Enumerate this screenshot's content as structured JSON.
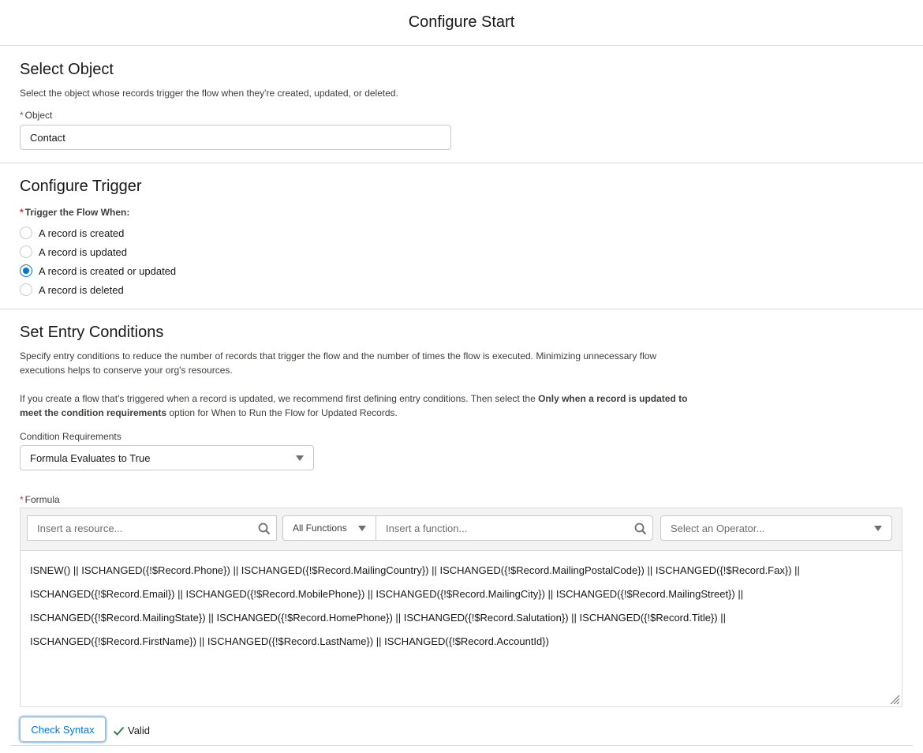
{
  "header": {
    "title": "Configure Start"
  },
  "select_object": {
    "title": "Select Object",
    "help": "Select the object whose records trigger the flow when they're created, updated, or deleted.",
    "field_label": "Object",
    "value": "Contact"
  },
  "configure_trigger": {
    "title": "Configure Trigger",
    "field_label": "Trigger the Flow When:",
    "options": [
      {
        "label": "A record is created",
        "checked": false
      },
      {
        "label": "A record is updated",
        "checked": false
      },
      {
        "label": "A record is created or updated",
        "checked": true
      },
      {
        "label": "A record is deleted",
        "checked": false
      }
    ]
  },
  "entry_conditions": {
    "title": "Set Entry Conditions",
    "help1": "Specify entry conditions to reduce the number of records that trigger the flow and the number of times the flow is executed. Minimizing unnecessary flow executions helps to conserve your org's resources.",
    "help2_before": "If you create a flow that's triggered when a record is updated, we recommend first defining entry conditions. Then select the ",
    "help2_bold": "Only when a record is updated to meet the condition requirements",
    "help2_after": " option for When to Run the Flow for Updated Records.",
    "condition_label": "Condition Requirements",
    "condition_value": "Formula Evaluates to True",
    "formula_label": "Formula",
    "resource_placeholder": "Insert a resource...",
    "functions_select": "All Functions",
    "function_placeholder": "Insert a function...",
    "operator_placeholder": "Select an Operator...",
    "formula": "ISNEW() || ISCHANGED({!$Record.Phone}) || ISCHANGED({!$Record.MailingCountry}) || ISCHANGED({!$Record.MailingPostalCode}) || ISCHANGED({!$Record.Fax}) || ISCHANGED({!$Record.Email}) || ISCHANGED({!$Record.MobilePhone}) || ISCHANGED({!$Record.MailingCity}) || ISCHANGED({!$Record.MailingStreet}) || ISCHANGED({!$Record.MailingState}) || ISCHANGED({!$Record.HomePhone}) || ISCHANGED({!$Record.Salutation}) || ISCHANGED({!$Record.Title}) || ISCHANGED({!$Record.FirstName}) || ISCHANGED({!$Record.LastName}) || ISCHANGED({!$Record.AccountId})",
    "check_syntax_label": "Check Syntax",
    "valid_label": "Valid"
  },
  "colors": {
    "brand": "#0176d3",
    "required": "#c23934",
    "valid_check": "#2e844a"
  }
}
